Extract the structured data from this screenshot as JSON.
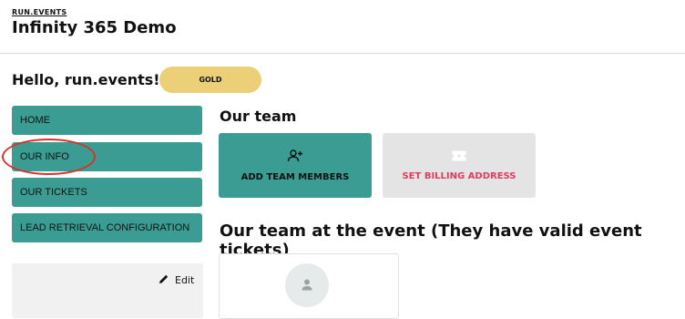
{
  "header": {
    "brand": "RUN.EVENTS",
    "title": "Infinity 365 Demo"
  },
  "greeting": {
    "text": "Hello, run.events! :)",
    "badge": "GOLD"
  },
  "nav": {
    "items": [
      {
        "label": "HOME"
      },
      {
        "label": "OUR INFO"
      },
      {
        "label": "OUR TICKETS"
      },
      {
        "label": "LEAD RETRIEVAL CONFIGURATION"
      }
    ]
  },
  "profile_panel": {
    "edit_label": "Edit"
  },
  "team": {
    "title": "Our team",
    "add_label": "ADD TEAM MEMBERS",
    "billing_label": "SET BILLING ADDRESS"
  },
  "event_team": {
    "title": "Our team at the event (They have valid event tickets)"
  },
  "colors": {
    "accent": "#3a9c92",
    "badge": "#ecd078",
    "billing_text": "#e03c5f",
    "annotation": "#d8322a"
  },
  "icons": {
    "add_member": "person-add-icon",
    "billing": "ticket-icon",
    "edit": "pencil-icon",
    "avatar": "person-icon"
  }
}
